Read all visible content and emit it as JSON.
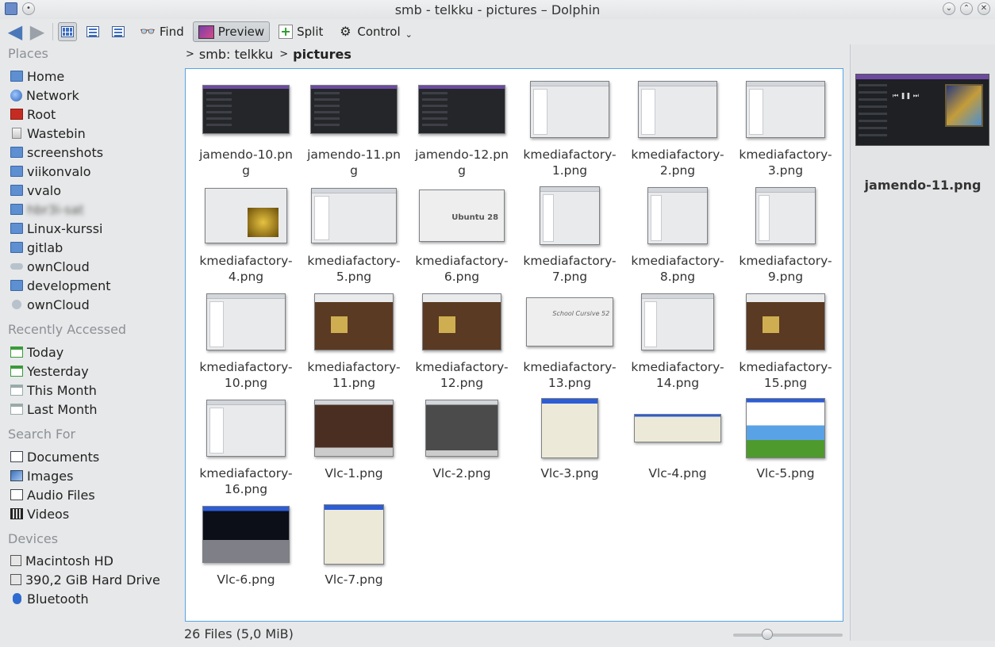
{
  "window": {
    "title": "smb - telkku - pictures – Dolphin"
  },
  "toolbar": {
    "find": "Find",
    "preview": "Preview",
    "split": "Split",
    "control": "Control"
  },
  "places": {
    "headings": {
      "places": "Places",
      "recent": "Recently Accessed",
      "search": "Search For",
      "devices": "Devices"
    },
    "items": [
      "Home",
      "Network",
      "Root",
      "Wastebin",
      "screenshots",
      "viikonvalo",
      "vvalo",
      "hbr3i-sat",
      "Linux-kurssi",
      "gitlab",
      "ownCloud",
      "development",
      "ownCloud"
    ],
    "recent": [
      "Today",
      "Yesterday",
      "This Month",
      "Last Month"
    ],
    "search": [
      "Documents",
      "Images",
      "Audio Files",
      "Videos"
    ],
    "devices": [
      "Macintosh HD",
      "390,2 GiB Hard Drive",
      "Bluetooth"
    ]
  },
  "breadcrumb": {
    "host": "smb: telkku",
    "current": "pictures"
  },
  "files": [
    "jamendo-10.png",
    "jamendo-11.png",
    "jamendo-12.png",
    "kmediafactory-1.png",
    "kmediafactory-2.png",
    "kmediafactory-3.png",
    "kmediafactory-4.png",
    "kmediafactory-5.png",
    "kmediafactory-6.png",
    "kmediafactory-7.png",
    "kmediafactory-8.png",
    "kmediafactory-9.png",
    "kmediafactory-10.png",
    "kmediafactory-11.png",
    "kmediafactory-12.png",
    "kmediafactory-13.png",
    "kmediafactory-14.png",
    "kmediafactory-15.png",
    "kmediafactory-16.png",
    "Vlc-1.png",
    "Vlc-2.png",
    "Vlc-3.png",
    "Vlc-4.png",
    "Vlc-5.png",
    "Vlc-6.png",
    "Vlc-7.png"
  ],
  "preview": {
    "filename": "jamendo-11.png"
  },
  "status": {
    "text": "26 Files (5,0 MiB)"
  }
}
